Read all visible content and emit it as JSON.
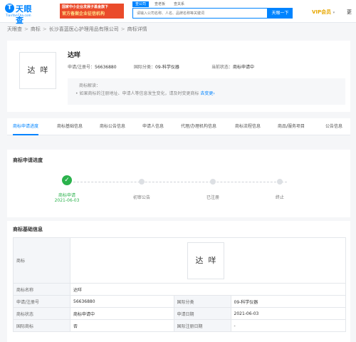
{
  "header": {
    "logo": {
      "icon": "T",
      "name": "天眼查",
      "domain": "TianYanCha.com"
    },
    "banner": {
      "line1": "国家中小企业发展子基金旗下",
      "line2": "官方备案企业征信机构"
    },
    "search_tabs": [
      "查公司",
      "查老板",
      "查关系"
    ],
    "search_placeholder": "请输入公司名称、人名、品牌名称等关键词",
    "search_button": "天眼一下",
    "vip": "VIP会员",
    "vip_caret": "▾",
    "more": "更"
  },
  "breadcrumb": [
    "天眼查",
    "商标",
    "长沙喜蓝医心护理用品有限公司",
    "商标详情"
  ],
  "trademark": {
    "image_text": "达咩",
    "name": "达咩",
    "meta": [
      {
        "label": "申请/注册号：",
        "value": "56636880"
      },
      {
        "label": "国际分类：",
        "value": "09-科学仪器"
      },
      {
        "label": "当前状态：",
        "value": "商标申请中"
      }
    ],
    "tip": {
      "title": "商标解读：",
      "bullet": "•",
      "text": "如果商标的注册地址、申请人等信息发生变化，请及时变更商标",
      "link": "去变更",
      "arrow": "›"
    }
  },
  "tabs": [
    "商标申请进度",
    "商标基础信息",
    "商标公告信息",
    "申请人信息",
    "代理/办理机构信息",
    "商标流程信息",
    "商品/服务项目",
    "公告信息"
  ],
  "progress": {
    "title": "商标申请进度",
    "check": "✓",
    "steps": [
      {
        "label": "商标申请",
        "date": "2021-06-03",
        "done": true
      },
      {
        "label": "初审公告",
        "done": false
      },
      {
        "label": "已注册",
        "done": false
      },
      {
        "label": "终止",
        "done": false
      }
    ]
  },
  "basic": {
    "title": "商标基础信息",
    "image_label": "商标",
    "image_text": "达咩",
    "name_label": "商标名称",
    "name_value": "达咩",
    "rows": [
      {
        "k1": "申请/注册号",
        "v1": "56636880",
        "k2": "国际分类",
        "v2": "09-科学仪器"
      },
      {
        "k1": "商标状态",
        "v1": "商标申请中",
        "k2": "申请日期",
        "v2": "2021-06-03"
      },
      {
        "k1": "国际商标",
        "v1": "否",
        "k2": "国际注册日期",
        "v2": "-"
      }
    ]
  },
  "colors": {
    "brand": "#0084ff",
    "success": "#2bb24c",
    "vip": "#e8a700",
    "banner": "#ea4b2b"
  }
}
